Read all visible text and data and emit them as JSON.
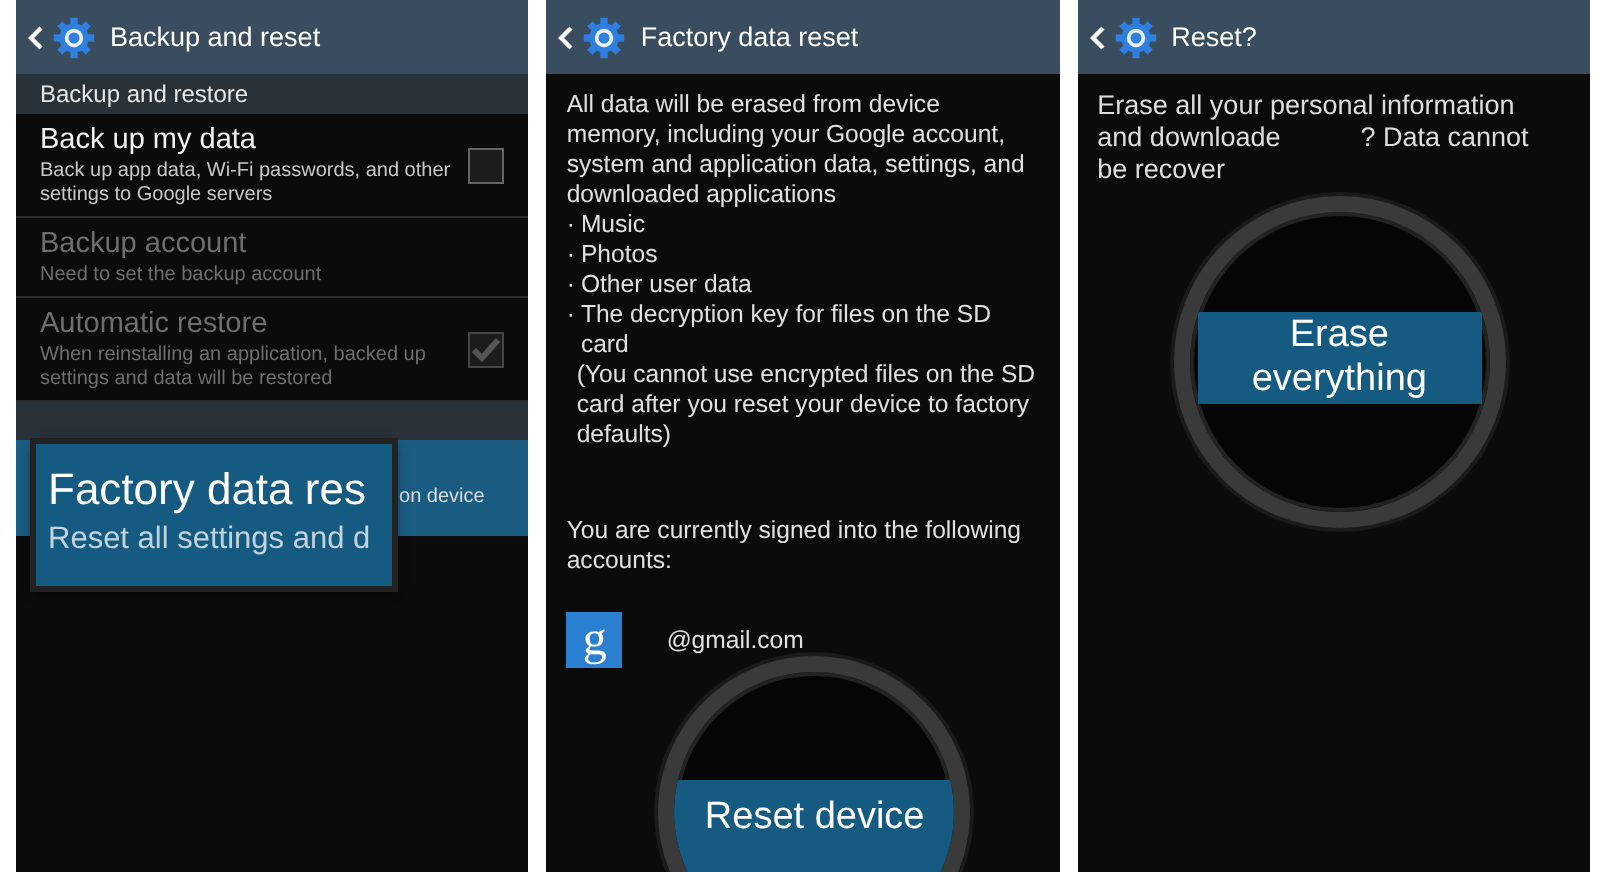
{
  "panels": [
    {
      "kind": "settings",
      "title": "Backup and reset",
      "section": "Backup and restore",
      "items": [
        {
          "title": "Back up my data",
          "subtitle": "Back up app data, Wi-Fi passwords, and other settings to Google servers",
          "disabled": false,
          "checkbox": true,
          "checked": false
        },
        {
          "title": "Backup account",
          "subtitle": "Need to set the backup account",
          "disabled": true,
          "checkbox": false
        },
        {
          "title": "Automatic restore",
          "subtitle": "When reinstalling an application, backed up settings and data will be restored",
          "disabled": true,
          "checkbox": true,
          "checked": true
        }
      ],
      "highlighted_item": {
        "visible_text": "on device",
        "selected": true
      },
      "magnifier": {
        "title": "Factory data res",
        "subtitle": "Reset all settings and d"
      }
    },
    {
      "kind": "info",
      "title": "Factory data reset",
      "intro": "All data will be erased from device memory, including your Google account, system and application data, settings, and downloaded applications",
      "bullet_mark": "·",
      "bullets": [
        "Music",
        "Photos",
        "Other user data",
        "The decryption key for files on the SD card"
      ],
      "note": "(You cannot use encrypted files on the SD card after you reset your device to factory defaults)",
      "signed_in": "You are currently signed into the following accounts:",
      "account": {
        "icon_letter": "g",
        "email": "@gmail.com"
      },
      "magnifier": {
        "button": "Reset device"
      }
    },
    {
      "kind": "confirm",
      "title": "Reset?",
      "message_lines": [
        [
          "Erase all your personal information"
        ],
        [
          "and downloade",
          "? Data cannot"
        ],
        [
          "be recover"
        ]
      ],
      "magnifier": {
        "button": "Erase everything"
      }
    }
  ]
}
